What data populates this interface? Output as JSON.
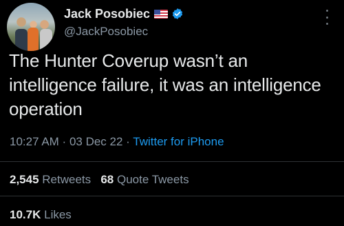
{
  "author": {
    "display_name": "Jack Posobiec",
    "handle": "@JackPosobiec",
    "flag_icon": "us-flag-icon",
    "verified_icon": "verified-badge-icon",
    "verified_color": "#1d9bf0"
  },
  "tweet": {
    "text": "The Hunter Coverup wasn’t an intelligence failure, it was an intelligence operation",
    "time": "10:27 AM",
    "separator1": " · ",
    "date": "03 Dec 22",
    "separator2": " · ",
    "source": "Twitter for iPhone"
  },
  "stats": {
    "retweets_count": "2,545",
    "retweets_label": "Retweets",
    "quotes_count": "68",
    "quotes_label": "Quote Tweets",
    "likes_count": "10.7K",
    "likes_label": "Likes"
  },
  "colors": {
    "background": "#000000",
    "primary_text": "#e7e9ea",
    "secondary_text": "#8b98a5",
    "link": "#1d9bf0"
  }
}
